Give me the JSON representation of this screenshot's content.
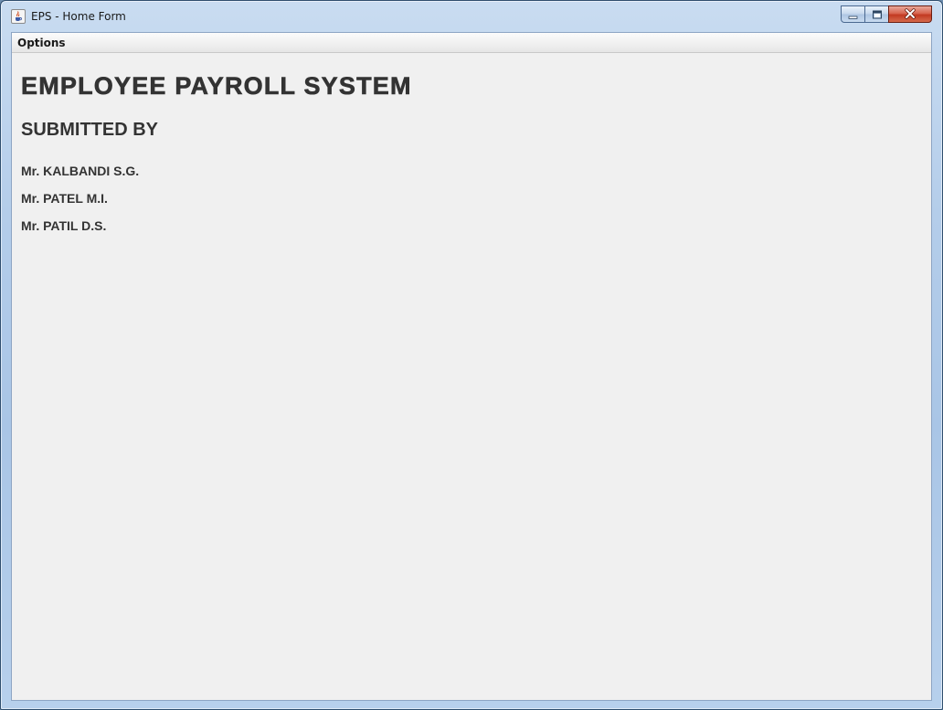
{
  "window": {
    "title": "EPS - Home Form",
    "icon": "java-cup-icon",
    "controls": {
      "minimize": "minimize-icon",
      "maximize": "maximize-icon",
      "close": "close-icon"
    }
  },
  "menubar": {
    "items": [
      {
        "label": "Options"
      }
    ]
  },
  "content": {
    "title": "EMPLOYEE PAYROLL SYSTEM",
    "subtitle": "SUBMITTED BY",
    "members": [
      "Mr. KALBANDI S.G.",
      "Mr. PATEL M.I.",
      "Mr. PATIL D.S."
    ]
  },
  "colors": {
    "window_frame": "#a9c5e6",
    "client_background": "#f0f0f0",
    "text": "#333333",
    "close_button": "#c23a22"
  }
}
